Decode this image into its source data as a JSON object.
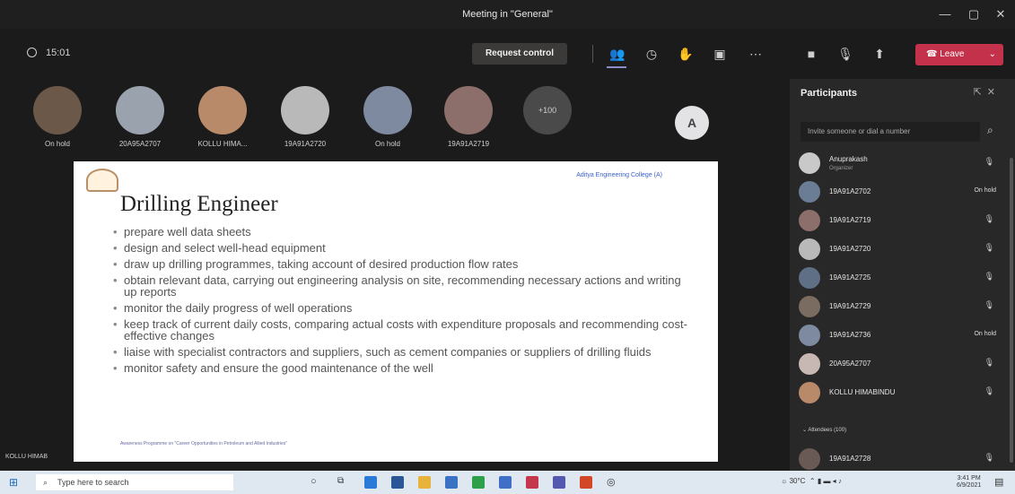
{
  "window": {
    "title": "Meeting in \"General\""
  },
  "callbar": {
    "timer": "15:01",
    "request_control": "Request control",
    "leave": "Leave"
  },
  "gallery": [
    {
      "label": "On hold",
      "color": "#6b5848"
    },
    {
      "label": "20A95A2707",
      "color": "#9aa3ad"
    },
    {
      "label": "KOLLU HIMA...",
      "color": "#b98a6a"
    },
    {
      "label": "19A91A2720",
      "color": "#b9b9b9"
    },
    {
      "label": "On hold",
      "color": "#7d8aa0"
    },
    {
      "label": "19A91A2719",
      "color": "#8c6f6a"
    },
    {
      "label": "+100",
      "color": "#4a4a4a"
    }
  ],
  "gallery_avatar_letter": "A",
  "slide": {
    "institution": "Aditya Engineering College (A)",
    "title": "Drilling Engineer",
    "bullets": [
      "prepare well data sheets",
      "design and select well-head equipment",
      "draw up drilling programmes, taking account of desired production flow rates",
      "obtain relevant data, carrying out engineering analysis on site, recommending necessary actions and writing up reports",
      "monitor the daily progress of well operations",
      "keep track of current daily costs, comparing actual costs with expenditure proposals and recommending cost-effective changes",
      "liaise with specialist contractors and suppliers, such as cement companies or suppliers of drilling fluids",
      "monitor safety and ensure the good maintenance of the well"
    ],
    "footer": "Awareness Programme on \"Career Opportunities in Petroleum and Allied Industries\""
  },
  "bottom_left_label": "KOLLU HIMAB",
  "participants": {
    "title": "Participants",
    "invite_placeholder": "Invite someone or dial a number",
    "people": [
      {
        "name": "Anuprakash",
        "role": "Organizer",
        "status": "",
        "color": "#c9c9c9"
      },
      {
        "name": "19A91A2702",
        "role": "",
        "status": "On hold",
        "color": "#6b7d94"
      },
      {
        "name": "19A91A2719",
        "role": "",
        "status": "",
        "color": "#8c6f6a"
      },
      {
        "name": "19A91A2720",
        "role": "",
        "status": "",
        "color": "#b9b9b9"
      },
      {
        "name": "19A91A2725",
        "role": "",
        "status": "",
        "color": "#5e6f86"
      },
      {
        "name": "19A91A2729",
        "role": "",
        "status": "",
        "color": "#7a6c60"
      },
      {
        "name": "19A91A2736",
        "role": "",
        "status": "On hold",
        "color": "#7d8aa0"
      },
      {
        "name": "20A95A2707",
        "role": "",
        "status": "",
        "color": "#c8b8b4"
      },
      {
        "name": "KOLLU HIMABINDU",
        "role": "",
        "status": "",
        "color": "#b98a6a"
      }
    ],
    "attendees_label": "Attendees (100)",
    "attendee_first": {
      "name": "19A91A2728",
      "color": "#6a5a55"
    }
  },
  "taskbar": {
    "search_placeholder": "Type here to search",
    "weather": "30°C",
    "time": "3:41 PM",
    "date": "6/9/2021"
  }
}
